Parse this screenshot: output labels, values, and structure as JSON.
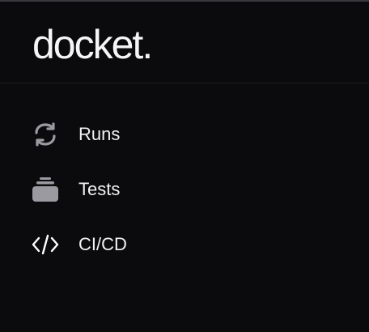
{
  "brand": {
    "name": "docket."
  },
  "nav": {
    "items": [
      {
        "label": "Runs",
        "icon": "refresh-icon"
      },
      {
        "label": "Tests",
        "icon": "stack-icon"
      },
      {
        "label": "CI/CD",
        "icon": "code-icon"
      }
    ]
  },
  "colors": {
    "background": "#0b0b0d",
    "text": "#f2f2f4",
    "icon_muted": "#9a9aa0",
    "divider": "#1d1d21"
  }
}
